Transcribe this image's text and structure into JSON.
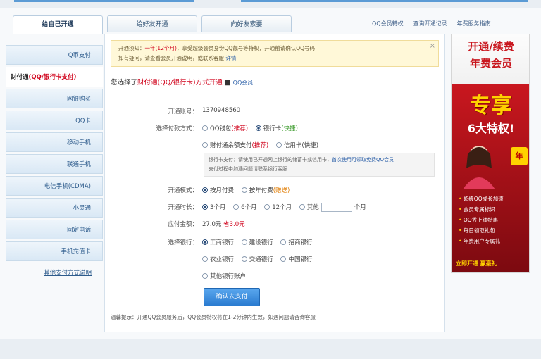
{
  "tabs": [
    {
      "label": "给自己开通",
      "active": true
    },
    {
      "label": "给好友开通",
      "active": false
    },
    {
      "label": "向好友索要",
      "active": false
    }
  ],
  "toplinks": [
    "QQ会员特权",
    "查询开通记录",
    "年费服务指南"
  ],
  "sidebar": {
    "items": [
      {
        "label": "Q币支付"
      },
      {
        "label_prefix": "财付通",
        "label_highlight": "(QQ/银行卡支付)",
        "active": true
      },
      {
        "label": "网银购买"
      },
      {
        "label": "QQ卡"
      },
      {
        "label": "移动手机"
      },
      {
        "label": "联通手机"
      },
      {
        "label": "电信手机(CDMA)"
      },
      {
        "label": "小灵通"
      },
      {
        "label": "固定电话"
      },
      {
        "label": "手机充值卡"
      },
      {
        "label": "其他支付方式说明",
        "link": true
      }
    ]
  },
  "notice": {
    "line1_a": "开通须知：",
    "line1_red": "一年(12个月)",
    "line1_b": "，享受超级会员身份QQ靓号等特权",
    "line1_c": "，开通前请确认QQ号码",
    "line2_a": "如有疑问，请查看会员开通说明，或联系客服",
    "line2_link": "详情",
    "close": "×"
  },
  "heading": {
    "prefix": "您选择了",
    "highlight": "财付通(QQ/银行卡)方式开通",
    "link": "QQ会员"
  },
  "form": {
    "account_label": "开通账号：",
    "account_value": "1370948560",
    "method_label": "选择付款方式：",
    "methods_row1": [
      {
        "label": "QQ钱包",
        "note": "(推荐)",
        "selected": false
      },
      {
        "label": "银行卡",
        "note": "(快捷)",
        "selected": true
      }
    ],
    "methods_row2": [
      {
        "label": "财付通余额支付",
        "note": "(推荐)",
        "selected": false
      },
      {
        "label": "信用卡",
        "note": "(快捷)",
        "selected": false
      }
    ],
    "hint_text": "银行卡支付：请使用已开通网上银行的储蓄卡或信用卡，",
    "hint_link": "首次使用可领取免费QQ会员",
    "hint_text2": "支付过程中如遇问题请联系银行客服",
    "mode_label": "开通模式：",
    "modes": [
      {
        "label": "按月付费",
        "selected": true
      },
      {
        "label": "按年付费",
        "note": "(赠送)",
        "selected": false
      }
    ],
    "duration_label": "开通时长：",
    "durations": [
      {
        "label": "3个月",
        "selected": true
      },
      {
        "label": "6个月",
        "selected": false
      },
      {
        "label": "12个月",
        "selected": false
      },
      {
        "label": "其他",
        "selected": false
      }
    ],
    "duration_unit": "个月",
    "amount_label": "应付金额：",
    "amount_value": "27.0元",
    "amount_note": "省3.0元",
    "bank_label": "选择银行：",
    "banks_row1": [
      {
        "label": "工商银行",
        "selected": true
      },
      {
        "label": "建设银行",
        "selected": false
      },
      {
        "label": "招商银行",
        "selected": false
      }
    ],
    "banks_row2": [
      {
        "label": "农业银行",
        "selected": false
      },
      {
        "label": "交通银行",
        "selected": false
      },
      {
        "label": "中国银行",
        "selected": false
      }
    ],
    "banks_row3": [
      {
        "label": "其他银行账户",
        "selected": false
      }
    ],
    "pay_button": "确认去支付"
  },
  "bottom_note": "温馨提示：开通QQ会员服务后，QQ会员特权将在1-2分钟内生效，如遇问题请咨询客服",
  "ad": {
    "title1": "开通/续费",
    "title2": "年费会员",
    "big": "专享",
    "sub": "6大特权!",
    "badge": "年",
    "list": [
      "超级QQ成长加速",
      "会员专属标识",
      "QQ秀上线特惠",
      "每日领取礼包",
      "年费用户专属礼"
    ],
    "footer": "立即开通 赢豪礼"
  },
  "colors": {
    "accent": "#2a7bd0",
    "highlight": "#d0021b",
    "sidebar_bg": "#d9e8f5",
    "ad_red": "#c9171f"
  }
}
